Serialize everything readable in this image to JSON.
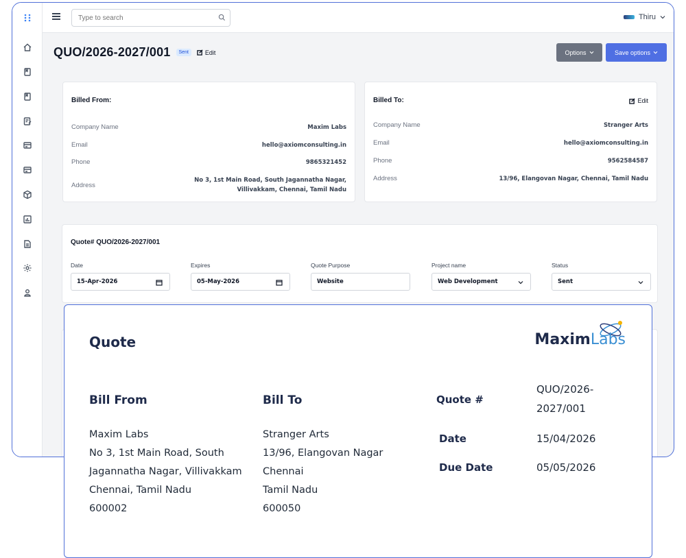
{
  "topbar": {
    "search_placeholder": "Type to search",
    "user_name": "Thiru"
  },
  "header": {
    "quote_id": "QUO/2026-2027/001",
    "status_badge": "Sent",
    "edit_label": "Edit"
  },
  "actions": {
    "options_label": "Options",
    "save_label": "Save options"
  },
  "billed_from": {
    "title": "Billed From:",
    "rows": [
      {
        "label": "Company Name",
        "value": "Maxim Labs"
      },
      {
        "label": "Email",
        "value": "hello@axiomconsulting.in"
      },
      {
        "label": "Phone",
        "value": "9865321452"
      },
      {
        "label": "Address",
        "value_line1": "No 3, 1st Main Road, South Jagannatha Nagar,",
        "value_line2": "Villivakkam, Chennai, Tamil Nadu"
      }
    ]
  },
  "billed_to": {
    "title": "Billed To:",
    "edit_label": "Edit",
    "rows": [
      {
        "label": "Company Name",
        "value": "Stranger Arts"
      },
      {
        "label": "Email",
        "value": "hello@axiomconsulting.in"
      },
      {
        "label": "Phone",
        "value": "9562584587"
      },
      {
        "label": "Address",
        "value": "13/96, Elangovan Nagar, Chennai, Tamil Nadu"
      }
    ]
  },
  "quote_form": {
    "title": "Quote# QUO/2026-2027/001",
    "fields": [
      {
        "label": "Date",
        "value": "15-Apr-2026"
      },
      {
        "label": "Expires",
        "value": "05-May-2026"
      },
      {
        "label": "Quote Purpose",
        "value": "Website"
      },
      {
        "label": "Project name",
        "value": "Web Development"
      },
      {
        "label": "Status",
        "value": "Sent"
      }
    ]
  },
  "preview": {
    "title": "Quote",
    "brand_main": "Maxim",
    "brand_sub": "Labs",
    "bill_from": {
      "heading": "Bill From",
      "lines": [
        "Maxim Labs",
        "No 3, 1st Main Road, South",
        "Jagannatha Nagar, Villivakkam",
        "Chennai, Tamil Nadu",
        "600002"
      ]
    },
    "bill_to": {
      "heading": "Bill To",
      "lines": [
        "Stranger Arts",
        "13/96, Elangovan Nagar",
        "Chennai",
        "Tamil Nadu",
        "600050"
      ]
    },
    "meta": {
      "quote_label": "Quote #",
      "quote_value_line1": "QUO/2026-",
      "quote_value_line2": "2027/001",
      "date_label": "Date",
      "date_value": "15/04/2026",
      "due_label": "Due Date",
      "due_value": "05/05/2026"
    }
  },
  "icons": [
    "apps-icon",
    "home-icon",
    "book-icon",
    "bookmark-icon",
    "invoice-icon",
    "card-icon",
    "card-alt-icon",
    "box-icon",
    "chart-icon",
    "document-icon",
    "settings-icon",
    "user-icon"
  ]
}
